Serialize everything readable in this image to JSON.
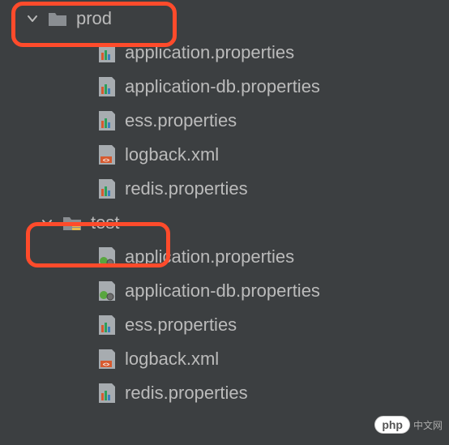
{
  "folders": [
    {
      "name": "prod",
      "files": [
        {
          "name": "application.properties",
          "icon": "props-bars"
        },
        {
          "name": "application-db.properties",
          "icon": "props-bars-alt"
        },
        {
          "name": "ess.properties",
          "icon": "props-bars"
        },
        {
          "name": "logback.xml",
          "icon": "xml"
        },
        {
          "name": "redis.properties",
          "icon": "props-bars-alt"
        }
      ]
    },
    {
      "name": "test",
      "files": [
        {
          "name": "application.properties",
          "icon": "props-spring"
        },
        {
          "name": "application-db.properties",
          "icon": "props-spring"
        },
        {
          "name": "ess.properties",
          "icon": "props-bars-alt"
        },
        {
          "name": "logback.xml",
          "icon": "xml"
        },
        {
          "name": "redis.properties",
          "icon": "props-bars-alt"
        }
      ]
    }
  ],
  "watermark": {
    "badge": "php",
    "text": "中文网"
  }
}
